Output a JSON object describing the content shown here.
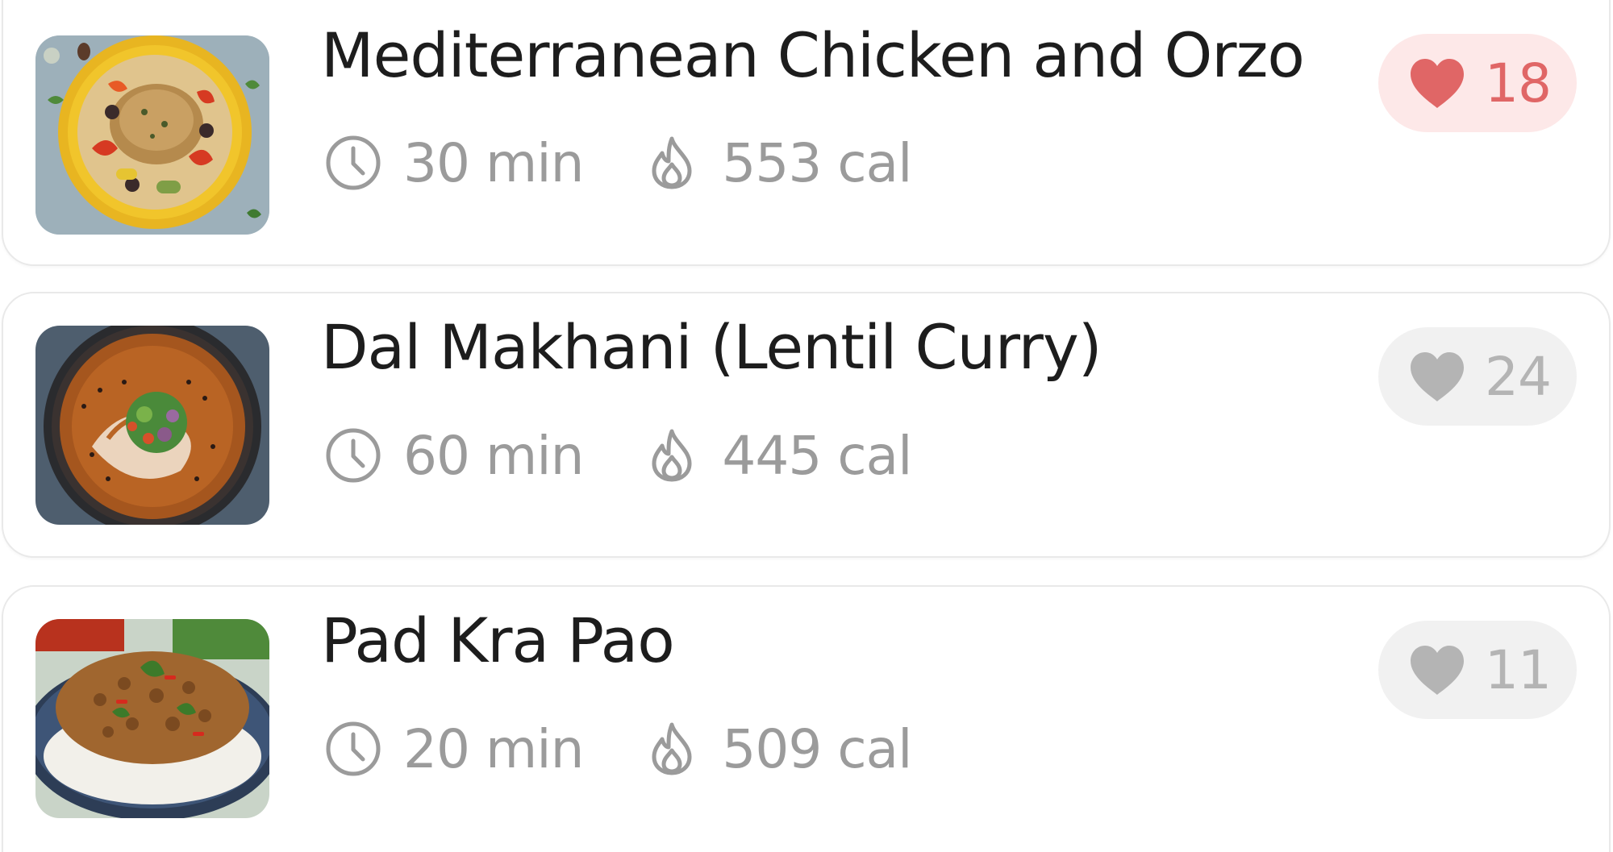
{
  "colors": {
    "title_text": "#1d1d1d",
    "meta_text": "#9b9b9b",
    "liked_bg": "#fde8e8",
    "liked_fg": "#e06666",
    "unliked_bg": "#f1f1f1",
    "unliked_fg": "#b4b4b4"
  },
  "recipes": [
    {
      "title": "Mediterranean Chicken and Orzo",
      "time": "30 min",
      "calories": "553 cal",
      "likes": "18",
      "liked": true,
      "image": "chicken-orzo-bowl"
    },
    {
      "title": "Dal Makhani (Lentil Curry)",
      "time": "60 min",
      "calories": "445 cal",
      "likes": "24",
      "liked": false,
      "image": "dal-makhani-bowl"
    },
    {
      "title": "Pad Kra Pao",
      "time": "20 min",
      "calories": "509 cal",
      "likes": "11",
      "liked": false,
      "image": "pad-kra-pao-plate"
    }
  ],
  "icons": {
    "time": "clock-icon",
    "calories": "flame-icon",
    "likes": "heart-icon"
  }
}
